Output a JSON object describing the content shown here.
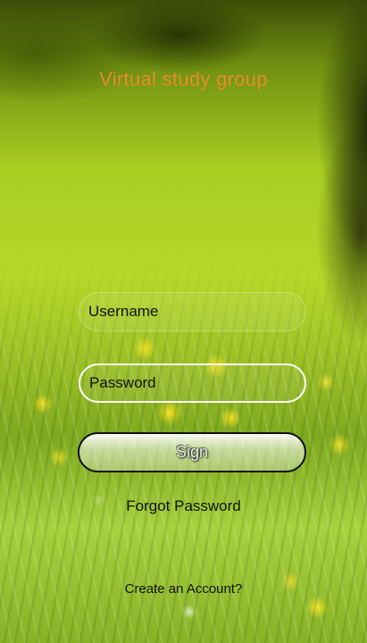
{
  "app": {
    "title": "Virtual study group"
  },
  "login": {
    "username_placeholder": "Username",
    "password_placeholder": "Password",
    "sign_label": "Sign",
    "forgot_password_label": "Forgot Password",
    "create_account_label": "Create an Account?"
  },
  "colors": {
    "title_text": "#e58a2f",
    "field_text": "#111111",
    "button_border": "#111111",
    "password_border": "#ffffff"
  }
}
